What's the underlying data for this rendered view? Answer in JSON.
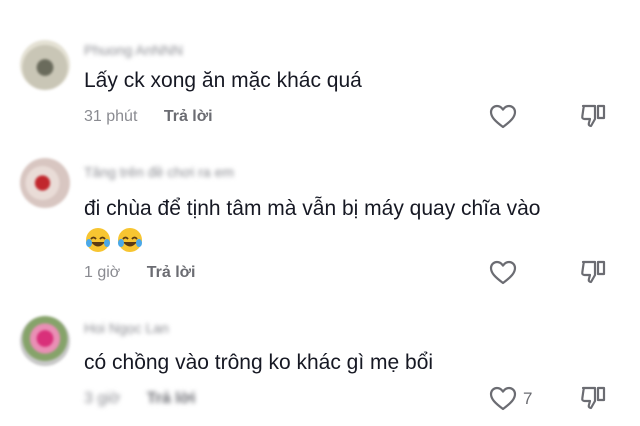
{
  "comments": [
    {
      "username": "Phuong AnNNN",
      "text": "Lấy ck xong ăn mặc khác quá",
      "time": "31 phút",
      "reply_label": "Trả lời",
      "like_count": ""
    },
    {
      "username": "Tăng trên đề chơi ra em",
      "text": "đi chùa để tịnh tâm mà vẫn bị máy quay chĩa vào",
      "emoji": [
        "laughing-crying",
        "laughing-crying"
      ],
      "time": "1 giờ",
      "reply_label": "Trả lời",
      "like_count": ""
    },
    {
      "username": "Hoi Ngọc Lan",
      "text": "có chồng vào trông ko khác gì mẹ bổi",
      "time": "3 giờ",
      "reply_label": "Trả lời",
      "like_count": "7"
    }
  ],
  "icons": {
    "like": "heart-outline-icon",
    "dislike": "thumbs-down-outline-icon",
    "emoji": "face-with-tears-of-joy"
  },
  "colors": {
    "text": "#161823",
    "secondary": "#8a8b91",
    "icon": "#6b6c72"
  }
}
